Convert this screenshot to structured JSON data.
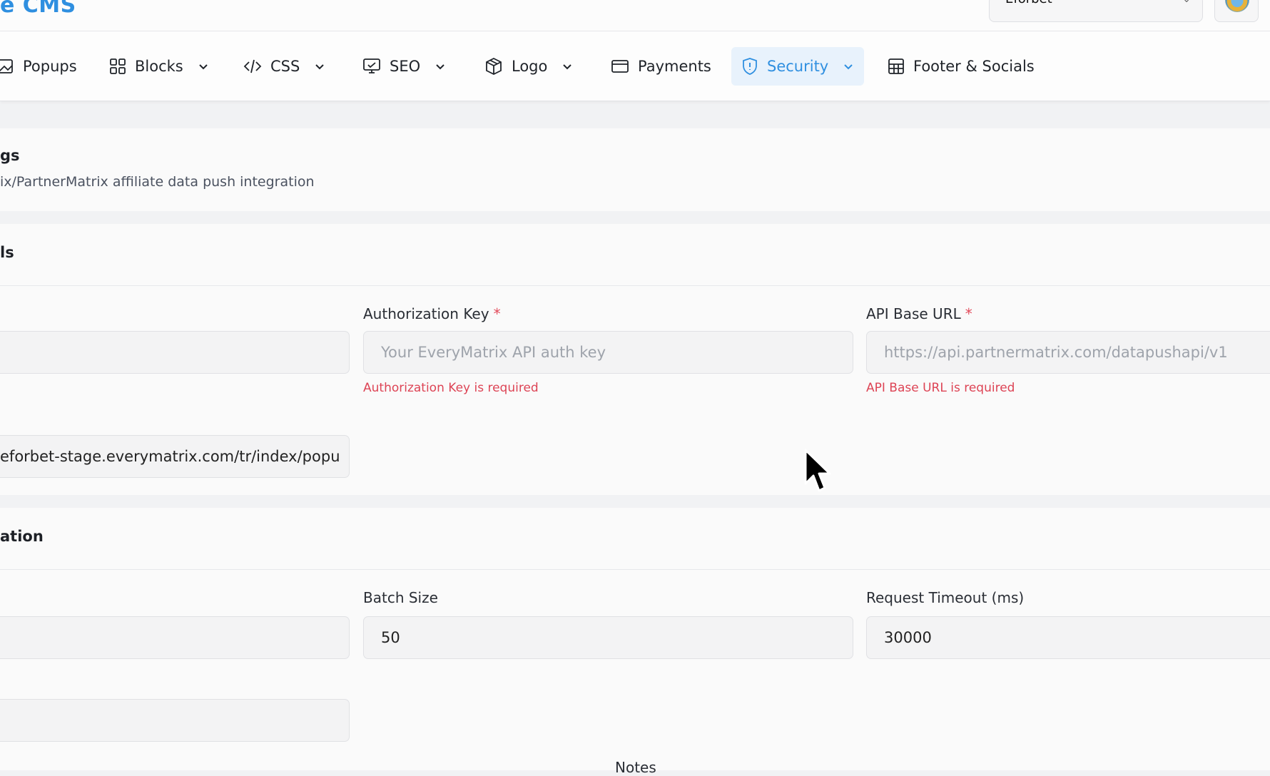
{
  "header": {
    "brand": "e CMS",
    "site_selector_value": "Eforbet",
    "avatar_icon": "globe-avatar-icon"
  },
  "nav": {
    "items": [
      {
        "label": "Popups",
        "icon": "image-icon"
      },
      {
        "label": "Blocks",
        "icon": "grid-icon"
      },
      {
        "label": "CSS",
        "icon": "code-icon"
      },
      {
        "label": "SEO",
        "icon": "monitor-icon"
      },
      {
        "label": "Logo",
        "icon": "box-icon"
      },
      {
        "label": "Payments",
        "icon": "card-icon"
      },
      {
        "label": "Security",
        "icon": "shield-icon",
        "active": true
      },
      {
        "label": "Footer & Socials",
        "icon": "table-icon"
      }
    ],
    "active_color": "#2f8fe0"
  },
  "settings": {
    "title": "gs",
    "subtitle": "ix/PartnerMatrix affiliate data push integration"
  },
  "credentials": {
    "title": "ls",
    "auth_key_label": "Authorization Key",
    "auth_key_required": "*",
    "auth_key_placeholder": "Your EveryMatrix API auth key",
    "auth_key_error": "Authorization Key is required",
    "api_url_label": "API Base URL",
    "api_url_required": "*",
    "api_url_placeholder": "https://api.partnermatrix.com/datapushapi/v1",
    "api_url_error": "API Base URL is required",
    "url_value": "eforbet-stage.everymatrix.com/tr/index/popu"
  },
  "configuration": {
    "title": "ation",
    "batch_size_label": "Batch Size",
    "batch_size_value": "50",
    "timeout_label": "Request Timeout (ms)",
    "timeout_value": "30000",
    "notes_label": "Notes"
  },
  "colors": {
    "accent": "#2f8fe0",
    "error": "#dd4455"
  }
}
